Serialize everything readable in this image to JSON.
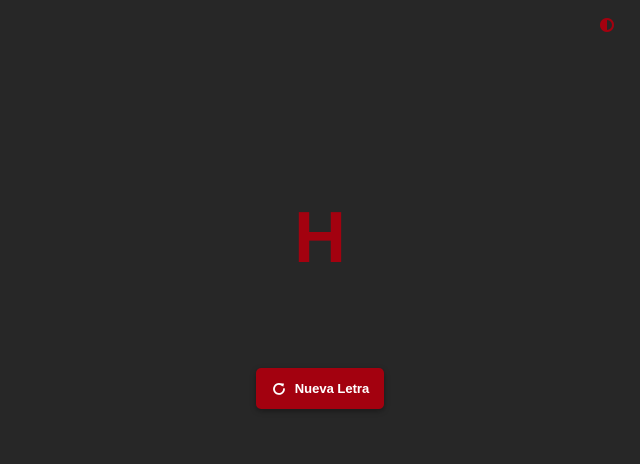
{
  "theme_toggle": {
    "icon": "contrast-icon",
    "color": "#a3010f"
  },
  "display": {
    "letter": "H",
    "color": "#a3010f"
  },
  "new_letter_button": {
    "label": "Nueva Letra",
    "icon": "refresh-icon",
    "background": "#a3010f",
    "text_color": "#ffffff"
  },
  "background": "#272727"
}
